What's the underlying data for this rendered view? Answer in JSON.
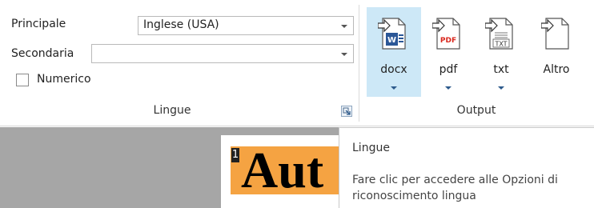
{
  "languages": {
    "primary_label": "Principale",
    "primary_value": "Inglese (USA)",
    "secondary_label": "Secondaria",
    "secondary_value": "",
    "numeric_label": "Numerico",
    "numeric_checked": false,
    "group_label": "Lingue"
  },
  "output": {
    "group_label": "Output",
    "buttons": [
      {
        "label": "docx",
        "icon": "word-document-icon",
        "active": true,
        "has_dropdown": true
      },
      {
        "label": "pdf",
        "icon": "pdf-document-icon",
        "active": false,
        "has_dropdown": true,
        "badge": "PDF"
      },
      {
        "label": "txt",
        "icon": "text-document-icon",
        "active": false,
        "has_dropdown": true,
        "badge": "TXT"
      },
      {
        "label": "Altro",
        "icon": "other-document-icon",
        "active": false,
        "has_dropdown": false
      }
    ]
  },
  "document": {
    "region_number": "1",
    "region_text": "Aut"
  },
  "tooltip": {
    "title": "Lingue",
    "body": "Fare clic per accedere alle Opzioni di\nriconoscimento lingua"
  },
  "colors": {
    "active_button": "#cde8f7",
    "word_blue": "#2b5797",
    "pdf_red": "#d9261c",
    "region_highlight": "#f5a342",
    "workspace": "#a6a6a6"
  }
}
